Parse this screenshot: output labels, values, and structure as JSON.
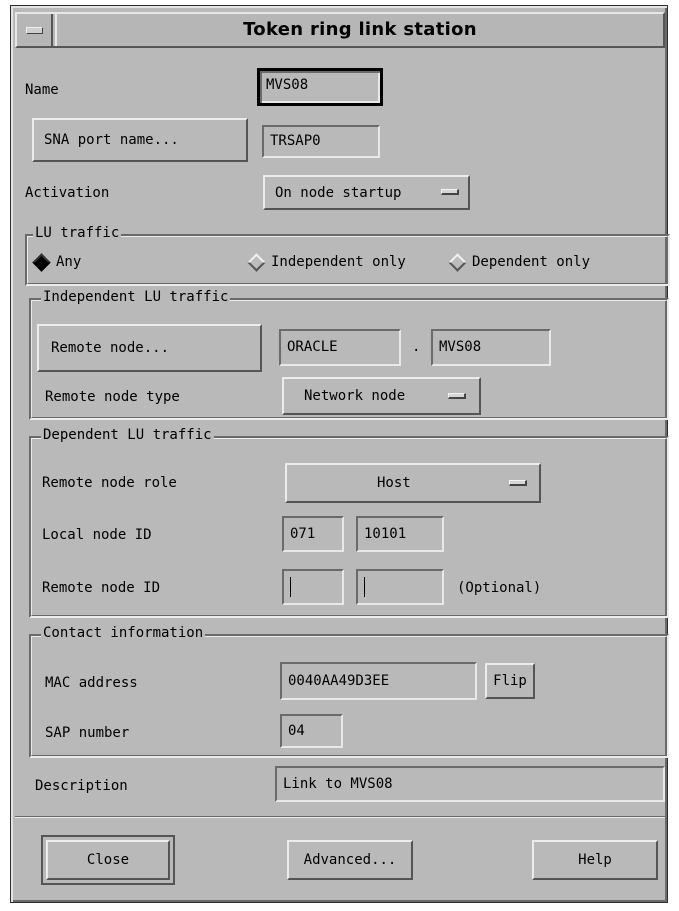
{
  "window": {
    "title": "Token ring link station",
    "menu_icon": "window-menu-icon"
  },
  "fields": {
    "name_label": "Name",
    "name_value": "MVS08",
    "sna_port_button": "SNA port name...",
    "sna_port_value": "TRSAP0",
    "activation_label": "Activation",
    "activation_value": "On node startup"
  },
  "lu_traffic": {
    "title": "LU traffic",
    "options": [
      "Any",
      "Independent only",
      "Dependent only"
    ],
    "selected": "Any"
  },
  "independent_lu": {
    "title": "Independent LU traffic",
    "remote_node_button": "Remote node...",
    "remote_node_network": "ORACLE",
    "separator": ".",
    "remote_node_name": "MVS08",
    "remote_node_type_label": "Remote node type",
    "remote_node_type_value": "Network node"
  },
  "dependent_lu": {
    "title": "Dependent LU traffic",
    "role_label": "Remote node role",
    "role_value": "Host",
    "local_id_label": "Local node ID",
    "local_id_block": "071",
    "local_id_num": "10101",
    "remote_id_label": "Remote node ID",
    "remote_id_block": "",
    "remote_id_num": "",
    "optional_note": "(Optional)"
  },
  "contact": {
    "title": "Contact information",
    "mac_label": "MAC address",
    "mac_value": "0040AA49D3EE",
    "flip_button": "Flip",
    "sap_label": "SAP number",
    "sap_value": "04"
  },
  "description": {
    "label": "Description",
    "value": "Link to MVS08"
  },
  "actions": {
    "close": "Close",
    "advanced": "Advanced...",
    "help": "Help"
  }
}
